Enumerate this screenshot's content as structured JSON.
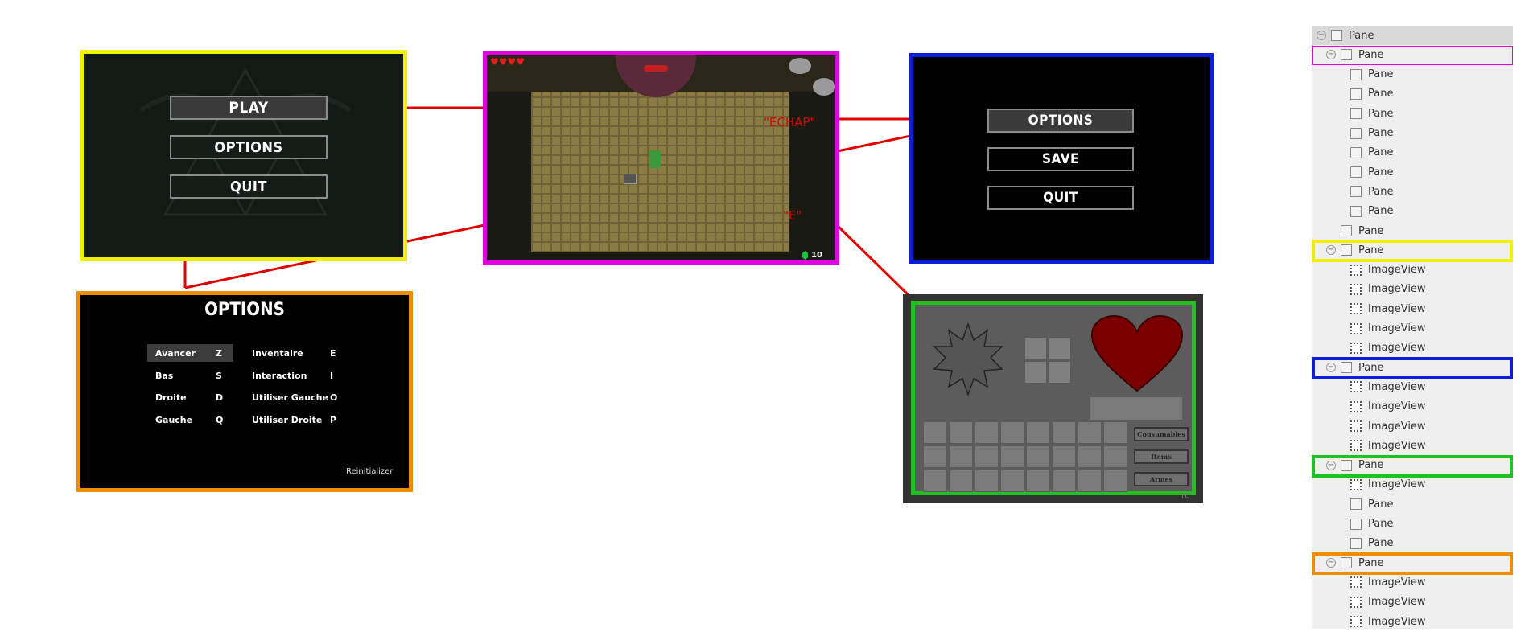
{
  "main_menu": {
    "play_label": "PLAY",
    "options_label": "OPTIONS",
    "quit_label": "QUIT",
    "border_color": "#f0f000"
  },
  "game_view": {
    "echap_label": "\"ECHAP\"",
    "e_label": "\"E\"",
    "rupee_count": "10",
    "border_color": "#e000e0"
  },
  "pause_menu": {
    "options_label": "OPTIONS",
    "save_label": "SAVE",
    "quit_label": "QUIT",
    "border_color": "#0b1fd6"
  },
  "options_menu": {
    "title": "OPTIONS",
    "bindings": [
      {
        "action": "Avancer",
        "key": "Z"
      },
      {
        "action": "Bas",
        "key": "S"
      },
      {
        "action": "Droite",
        "key": "D"
      },
      {
        "action": "Gauche",
        "key": "Q"
      },
      {
        "action": "Inventaire",
        "key": "E"
      },
      {
        "action": "Interaction",
        "key": "I"
      },
      {
        "action": "Utiliser Gauche",
        "key": "O"
      },
      {
        "action": "Utiliser Droite",
        "key": "P"
      }
    ],
    "reset_label": "Reinitializer",
    "border_color": "#f08c00"
  },
  "inventory": {
    "tabs": [
      "Consumables",
      "Items",
      "Armes"
    ],
    "rupee_count": "10",
    "border_color": "#22c022"
  },
  "connector_color": "#e00000",
  "tree": {
    "rows": [
      {
        "label": "Pane",
        "type": "pane",
        "indent": 0,
        "toggle": true
      },
      {
        "label": "Pane",
        "type": "pane",
        "indent": 1,
        "toggle": true
      },
      {
        "label": "Pane",
        "type": "pane",
        "indent": 2,
        "toggle": false
      },
      {
        "label": "Pane",
        "type": "pane",
        "indent": 2,
        "toggle": false
      },
      {
        "label": "Pane",
        "type": "pane",
        "indent": 2,
        "toggle": false
      },
      {
        "label": "Pane",
        "type": "pane",
        "indent": 2,
        "toggle": false
      },
      {
        "label": "Pane",
        "type": "pane",
        "indent": 2,
        "toggle": false
      },
      {
        "label": "Pane",
        "type": "pane",
        "indent": 2,
        "toggle": false
      },
      {
        "label": "Pane",
        "type": "pane",
        "indent": 2,
        "toggle": false
      },
      {
        "label": "Pane",
        "type": "pane",
        "indent": 2,
        "toggle": false
      },
      {
        "label": "Pane",
        "type": "pane",
        "indent": 1,
        "toggle": false
      },
      {
        "label": "Pane",
        "type": "pane",
        "indent": 1,
        "toggle": true
      },
      {
        "label": "ImageView",
        "type": "image",
        "indent": 2,
        "toggle": false
      },
      {
        "label": "ImageView",
        "type": "image",
        "indent": 2,
        "toggle": false
      },
      {
        "label": "ImageView",
        "type": "image",
        "indent": 2,
        "toggle": false
      },
      {
        "label": "ImageView",
        "type": "image",
        "indent": 2,
        "toggle": false
      },
      {
        "label": "ImageView",
        "type": "image",
        "indent": 2,
        "toggle": false
      },
      {
        "label": "Pane",
        "type": "pane",
        "indent": 1,
        "toggle": true
      },
      {
        "label": "ImageView",
        "type": "image",
        "indent": 2,
        "toggle": false
      },
      {
        "label": "ImageView",
        "type": "image",
        "indent": 2,
        "toggle": false
      },
      {
        "label": "ImageView",
        "type": "image",
        "indent": 2,
        "toggle": false
      },
      {
        "label": "ImageView",
        "type": "image",
        "indent": 2,
        "toggle": false
      },
      {
        "label": "Pane",
        "type": "pane",
        "indent": 1,
        "toggle": true
      },
      {
        "label": "ImageView",
        "type": "image",
        "indent": 2,
        "toggle": false
      },
      {
        "label": "Pane",
        "type": "pane",
        "indent": 2,
        "toggle": false
      },
      {
        "label": "Pane",
        "type": "pane",
        "indent": 2,
        "toggle": false
      },
      {
        "label": "Pane",
        "type": "pane",
        "indent": 2,
        "toggle": false
      },
      {
        "label": "Pane",
        "type": "pane",
        "indent": 1,
        "toggle": true
      },
      {
        "label": "ImageView",
        "type": "image",
        "indent": 2,
        "toggle": false
      },
      {
        "label": "ImageView",
        "type": "image",
        "indent": 2,
        "toggle": false
      },
      {
        "label": "ImageView",
        "type": "image",
        "indent": 2,
        "toggle": false
      }
    ]
  }
}
